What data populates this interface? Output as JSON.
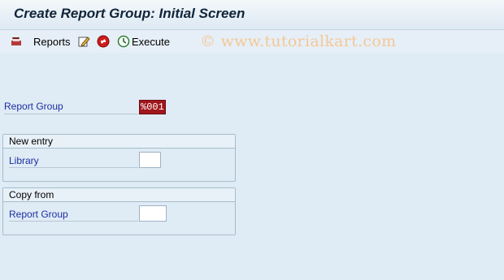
{
  "window": {
    "title": "Create Report Group: Initial Screen"
  },
  "toolbar": {
    "reports_label": "Reports",
    "execute_label": "Execute"
  },
  "watermark": "© www.tutorialkart.com",
  "report_group": {
    "label": "Report Group",
    "value": "%001"
  },
  "new_entry": {
    "heading": "New entry",
    "library_label": "Library",
    "library_value": ""
  },
  "copy_from": {
    "heading": "Copy from",
    "report_group_label": "Report Group",
    "report_group_value": ""
  }
}
